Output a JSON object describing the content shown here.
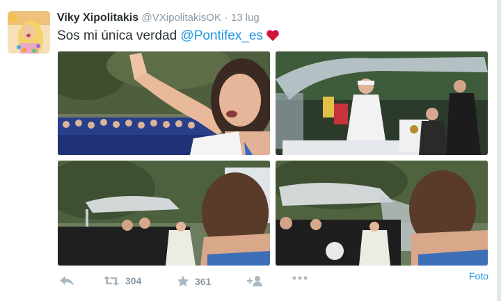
{
  "tweet": {
    "display_name": "Viky Xipolitakis",
    "handle": "@VXipolitakisOK",
    "separator": "·",
    "timestamp": "13 lug",
    "text_before": "Sos mi única verdad ",
    "mention": "@Pontifex_es",
    "emoji": "red-heart-icon"
  },
  "photos": [
    {
      "name": "photo-woman-waving-crowd"
    },
    {
      "name": "photo-pope-in-popemobile"
    },
    {
      "name": "photo-popemobile-behind-woman"
    },
    {
      "name": "photo-popemobile-behind-woman-2"
    }
  ],
  "actions": {
    "reply_icon": "reply-icon",
    "retweet_icon": "retweet-icon",
    "retweet_count": "304",
    "favorite_icon": "star-icon",
    "favorite_count": "361",
    "follow_icon": "follow-icon",
    "more_icon": "more-icon",
    "media_link": "Foto"
  },
  "colors": {
    "link": "#1b95e0",
    "muted": "#8899a6",
    "text": "#292f33",
    "heart": "#e0245e"
  }
}
